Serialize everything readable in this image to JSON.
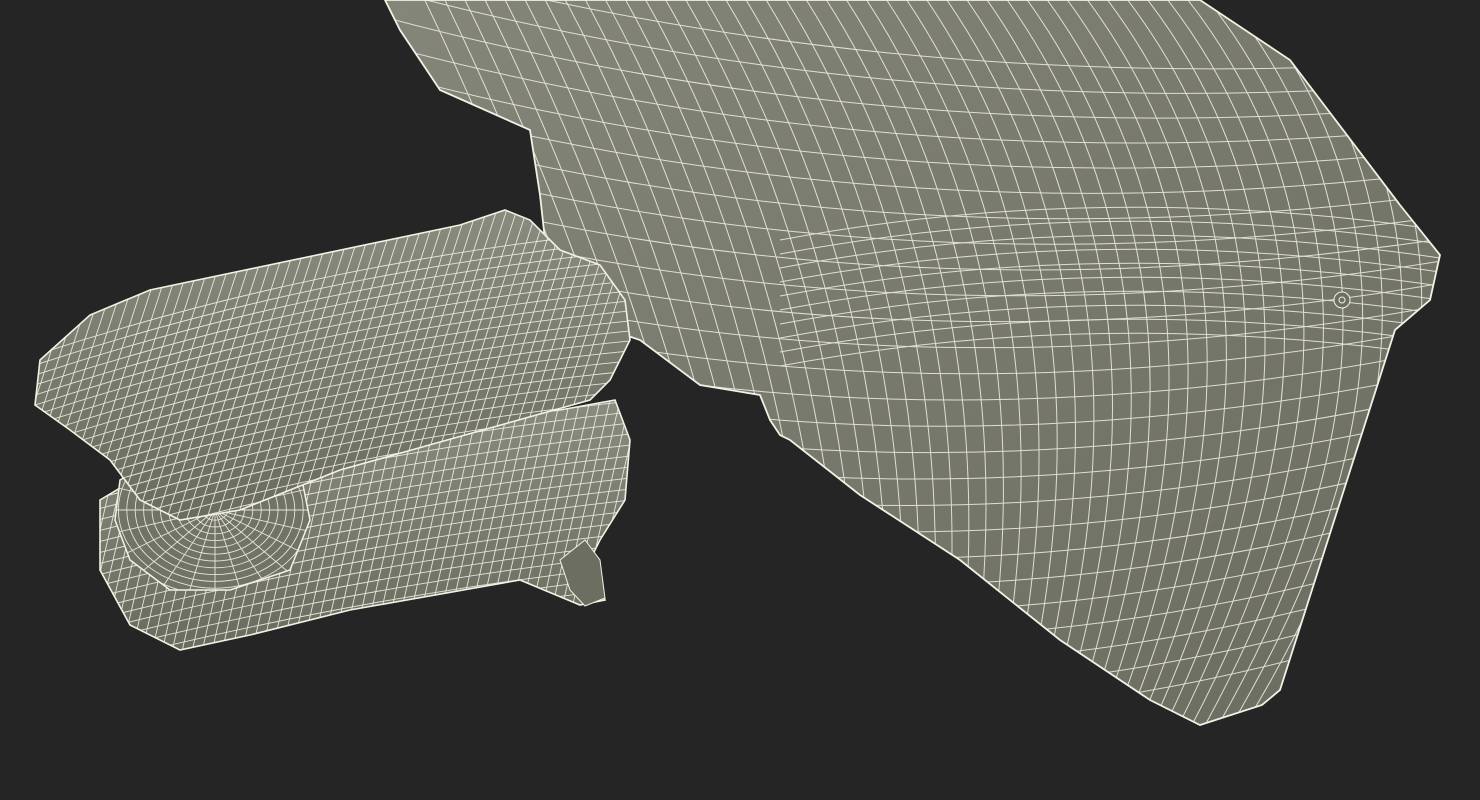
{
  "scene": {
    "background_color": "#252525",
    "surface_color": "#7b7c6f",
    "surface_shade_color": "#6c6d61",
    "wire_color": "#f2f1e4",
    "subject": "wireframe-3d-model"
  }
}
